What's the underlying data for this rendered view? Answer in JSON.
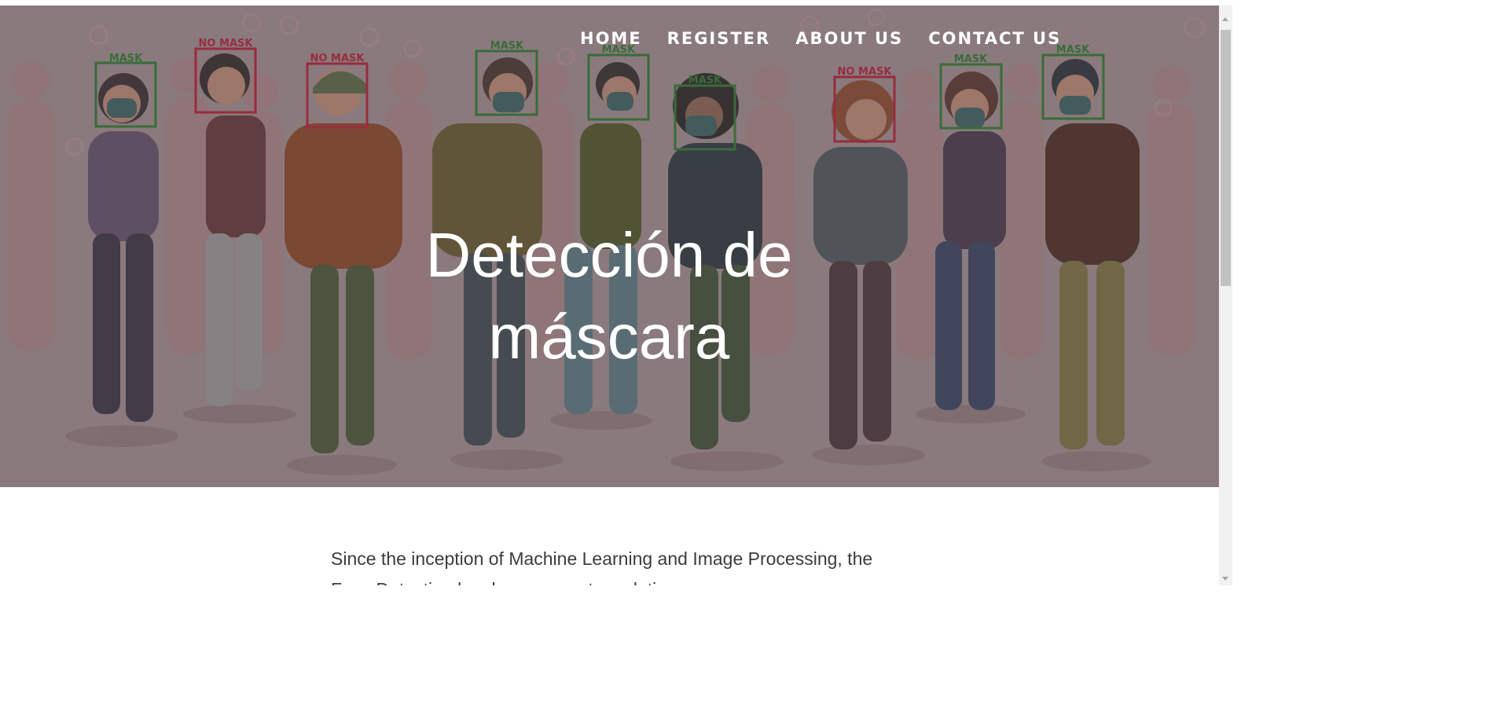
{
  "nav": {
    "items": [
      {
        "label": "HOME"
      },
      {
        "label": "REGISTER"
      },
      {
        "label": "ABOUT US"
      },
      {
        "label": "CONTACT US"
      }
    ]
  },
  "hero": {
    "title": "Detección de máscara",
    "image": {
      "labels": [
        "MASK",
        "NO MASK",
        "NO MASK",
        "MASK",
        "MASK",
        "MASK",
        "NO MASK",
        "MASK",
        "MASK"
      ],
      "colors": {
        "overlay": "#8f7f82",
        "mask_box": "#1f6b23",
        "no_mask_box": "#a3132a"
      }
    }
  },
  "content": {
    "intro": "Since the inception of Machine Learning and Image Processing, the Face Detection has been a great revolution."
  }
}
